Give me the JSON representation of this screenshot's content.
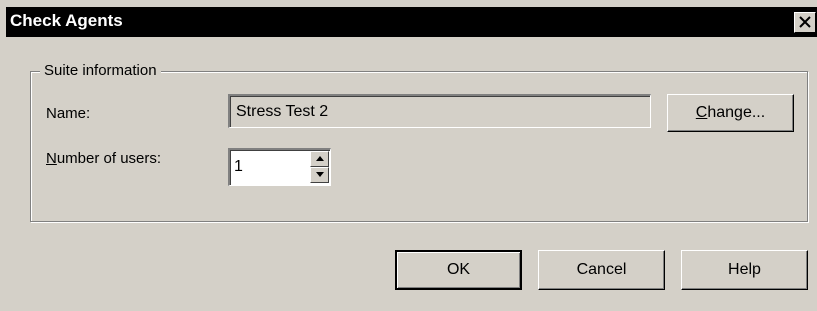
{
  "window": {
    "title": "Check Agents",
    "close_icon": "close-icon"
  },
  "suite": {
    "legend": "Suite information",
    "name_label": "Name:",
    "name_value": "Stress Test 2",
    "change_label_accel": "C",
    "change_label_rest": "hange...",
    "users_label_accel": "N",
    "users_label_rest": "umber of users:",
    "users_value": "1"
  },
  "buttons": {
    "ok": "OK",
    "cancel": "Cancel",
    "help": "Help"
  },
  "icons": {
    "spin_up": "arrow-up-icon",
    "spin_down": "arrow-down-icon"
  }
}
